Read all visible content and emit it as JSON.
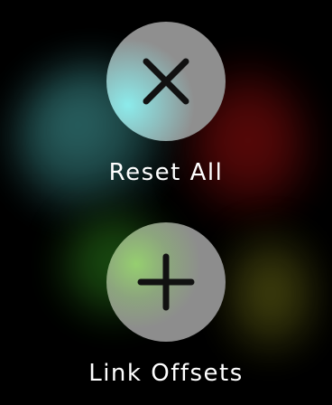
{
  "actions": {
    "reset": {
      "label": "Reset All",
      "icon": "close-icon"
    },
    "link": {
      "label": "Link Offsets",
      "icon": "plus-icon"
    }
  },
  "colors": {
    "background": "#000000",
    "button_fill": "#8f8f8f",
    "icon": "#111111",
    "label": "#ffffff"
  }
}
